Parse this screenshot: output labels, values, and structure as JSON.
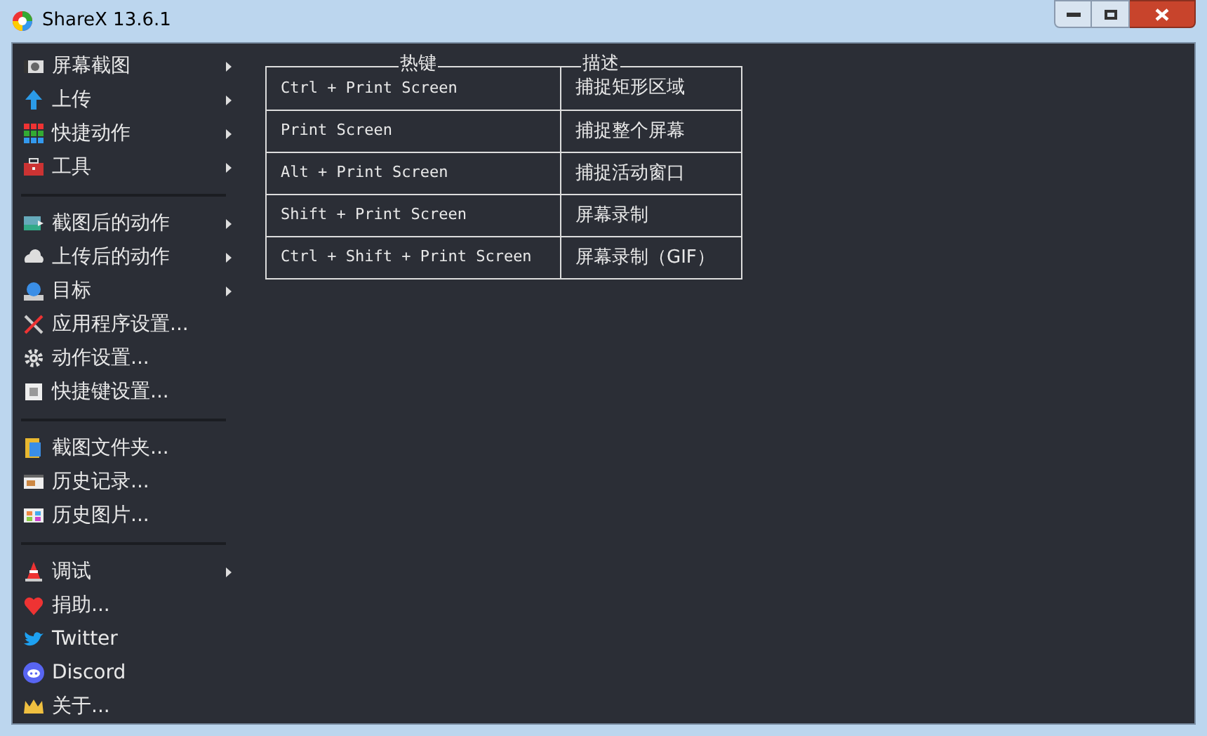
{
  "window": {
    "title": "ShareX 13.6.1"
  },
  "menu_groups": [
    [
      {
        "label": "屏幕截图",
        "submenu": true
      },
      {
        "label": "上传",
        "submenu": true
      },
      {
        "label": "快捷动作",
        "submenu": true
      },
      {
        "label": "工具",
        "submenu": true
      }
    ],
    [
      {
        "label": "截图后的动作",
        "submenu": true
      },
      {
        "label": "上传后的动作",
        "submenu": true
      },
      {
        "label": "目标",
        "submenu": true
      },
      {
        "label": "应用程序设置...",
        "submenu": false
      },
      {
        "label": "动作设置...",
        "submenu": false
      },
      {
        "label": "快捷键设置...",
        "submenu": false
      }
    ],
    [
      {
        "label": "截图文件夹...",
        "submenu": false
      },
      {
        "label": "历史记录...",
        "submenu": false
      },
      {
        "label": "历史图片...",
        "submenu": false
      }
    ],
    [
      {
        "label": "调试",
        "submenu": true
      },
      {
        "label": "捐助...",
        "submenu": false
      },
      {
        "label": "Twitter",
        "submenu": false
      },
      {
        "label": "Discord",
        "submenu": false
      },
      {
        "label": "关于...",
        "submenu": false
      }
    ]
  ],
  "hotkeys": {
    "columns": [
      "热键",
      "描述"
    ],
    "rows": [
      [
        "Ctrl + Print Screen",
        "捕捉矩形区域"
      ],
      [
        "Print Screen",
        "捕捉整个屏幕"
      ],
      [
        "Alt + Print Screen",
        "捕捉活动窗口"
      ],
      [
        "Shift + Print Screen",
        "屏幕录制"
      ],
      [
        "Ctrl + Shift + Print Screen",
        "屏幕录制（GIF）"
      ]
    ]
  }
}
